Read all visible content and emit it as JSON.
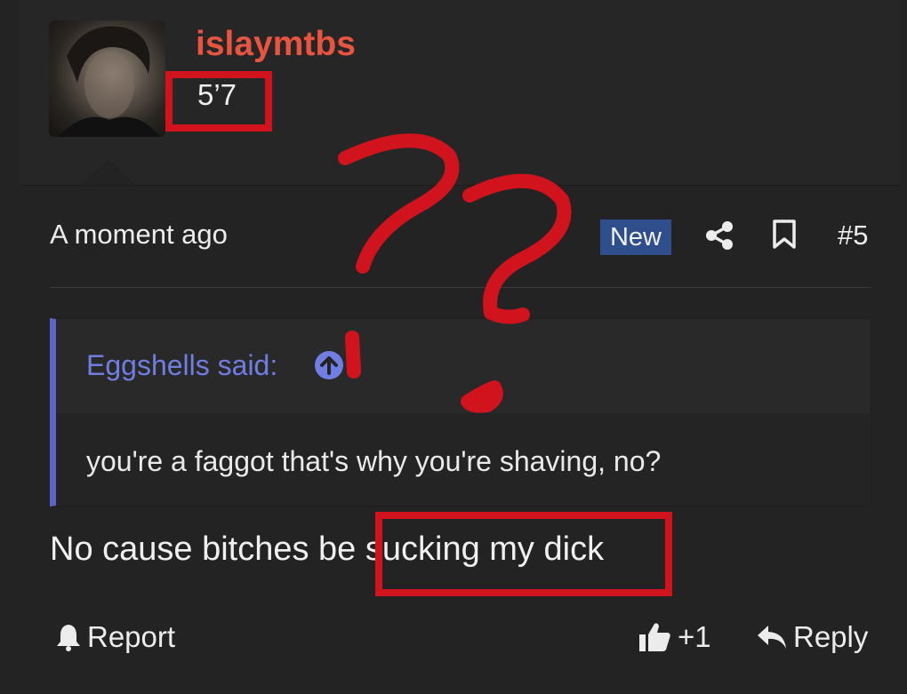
{
  "user": {
    "username": "islaymtbs",
    "title": "5’7"
  },
  "post": {
    "timestamp": "A moment ago",
    "new_badge": "New",
    "number": "#5",
    "body": "No cause bitches be sucking my dick"
  },
  "quote": {
    "author": "Eggshells said:",
    "text": "you're a faggot that's why you're shaving, no?"
  },
  "actions": {
    "report": "Report",
    "like_count": "+1",
    "reply": "Reply"
  },
  "icons": [
    "share-icon",
    "bookmark-icon",
    "arrow-up-circle-icon",
    "bell-icon",
    "thumbs-up-icon",
    "reply-arrow-icon"
  ],
  "colors": {
    "username": "#e8543f",
    "badge": "#2f4f8c",
    "quote_accent": "#5b66c4",
    "annotation_red": "#d0131d"
  }
}
